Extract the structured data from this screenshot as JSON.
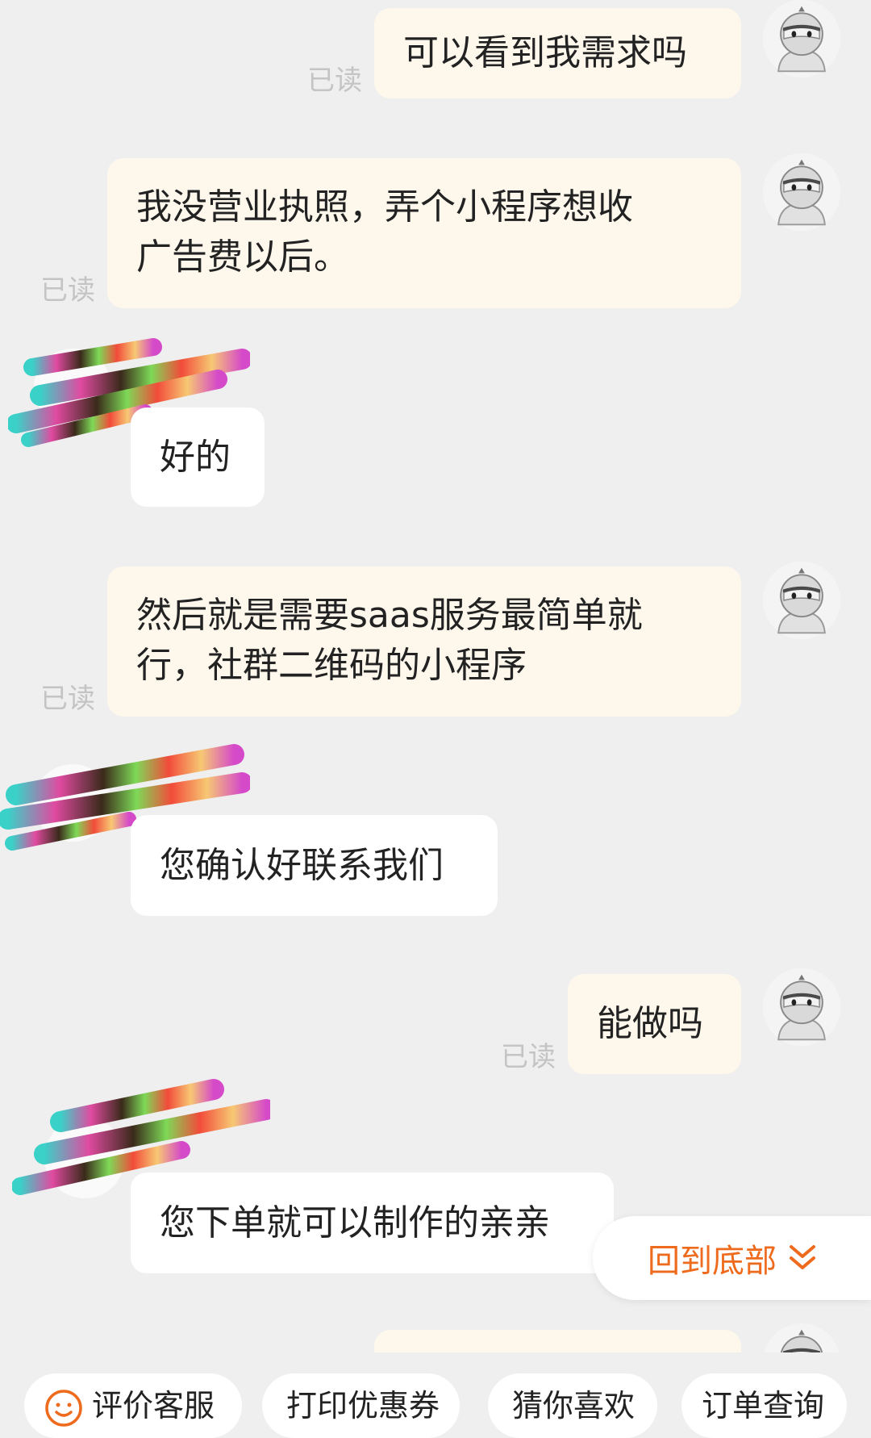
{
  "messages": [
    {
      "text": "可以看到我需求吗",
      "read": "已读"
    },
    {
      "text_lines": [
        "我没营业执照，弄个小程序想收",
        "广告费以后。"
      ],
      "read": "已读"
    },
    {
      "text": "好的"
    },
    {
      "text_lines": [
        "然后就是需要saas服务最简单就",
        "行，社群二维码的小程序"
      ],
      "read": "已读"
    },
    {
      "text": "您确认好联系我们"
    },
    {
      "text": "能做吗",
      "read": "已读"
    },
    {
      "text": "您下单就可以制作的亲亲"
    }
  ],
  "back_to_bottom": {
    "label": "回到底部"
  },
  "quick_actions": [
    {
      "label": "评价客服"
    },
    {
      "label": "打印优惠券"
    },
    {
      "label": "猜你喜欢"
    },
    {
      "label": "订单查询"
    }
  ],
  "colors": {
    "background": "#efefef",
    "outgoing_bubble": "#fdf7ec",
    "incoming_bubble": "#ffffff",
    "read_text": "#c4c4c4",
    "accent": "#ee6a1c"
  },
  "icons": {
    "user_avatar": "ninja-avatar-icon",
    "agent_avatar": "redacted-avatar",
    "back_to_bottom": "double-chevron-down-icon",
    "rate_service": "smiley-face-icon"
  }
}
